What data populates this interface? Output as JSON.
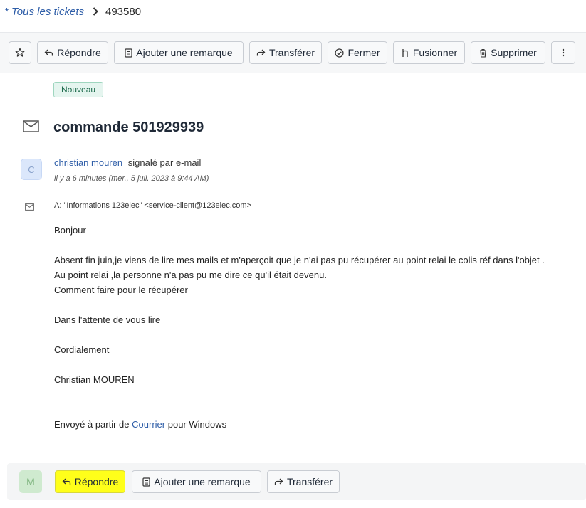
{
  "breadcrumb": {
    "all_tickets": "* Tous les tickets",
    "ticket_id": "493580"
  },
  "toolbar": {
    "reply": "Répondre",
    "add_note": "Ajouter une remarque",
    "forward": "Transférer",
    "close": "Fermer",
    "merge": "Fusionner",
    "delete": "Supprimer"
  },
  "ticket": {
    "status": "Nouveau",
    "subject": "commande 501929939"
  },
  "message": {
    "avatar_initial": "C",
    "author": "christian mouren",
    "via": "signalé par e-mail",
    "timestamp": "il y a 6 minutes (mer., 5 juil. 2023 à 9:44 AM)",
    "to": "A: \"Informations 123elec\" <service-client@123elec.com>",
    "body": {
      "greeting": "Bonjour",
      "line1": "Absent fin juin,je viens de lire mes mails et m'aperçoit que je n'ai pas pu récupérer au point relai le colis réf dans l'objet .",
      "line2": "Au point relai ,la personne n'a pas pu me dire ce qu'il était devenu.",
      "line3": "Comment faire pour le récupérer",
      "waiting": "Dans l'attente de vous lire",
      "closing": "Cordialement",
      "signature": "Christian MOUREN",
      "sent_prefix": "Envoyé à partir de",
      "sent_link": "Courrier",
      "sent_suffix": "pour Windows"
    }
  },
  "reply_bar": {
    "avatar_initial": "M",
    "reply": "Répondre",
    "add_note": "Ajouter une remarque",
    "forward": "Transférer"
  },
  "colors": {
    "link": "#2f5ea8",
    "status_bg": "#e5f5ef",
    "status_text": "#1d6b4c",
    "highlight": "#ffff1a",
    "toolbar_bg": "#f6f7f8"
  },
  "icons": [
    "chevron-right-icon",
    "star-icon",
    "reply-icon",
    "note-icon",
    "forward-icon",
    "check-circle-icon",
    "merge-icon",
    "trash-icon",
    "more-vertical-icon",
    "envelope-icon"
  ]
}
